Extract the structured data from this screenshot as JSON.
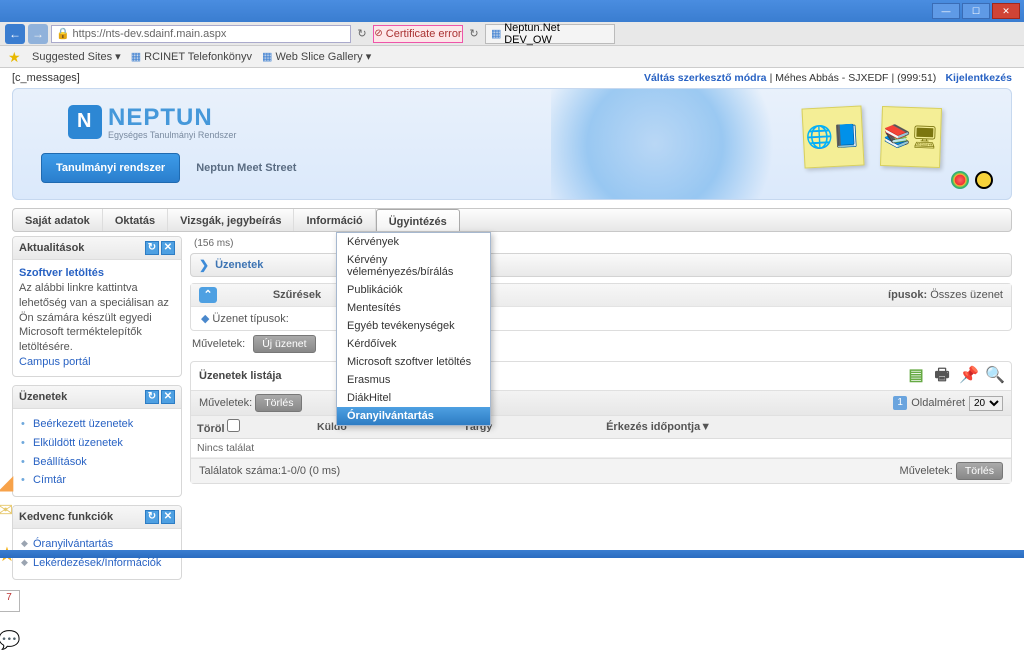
{
  "browser": {
    "url": "https://nts-dev.sdainf.main.aspx",
    "cert_error": "Certificate error",
    "tab_title": "Neptun.Net DEV_OW",
    "fav_sites": "Suggested Sites ▾",
    "fav_phone": "RCINET Telefonkönyv",
    "fav_slice": "Web Slice Gallery ▾"
  },
  "topbar": {
    "messages": "[c_messages]",
    "switch_mode": "Váltás szerkesztő módra",
    "user": "Méhes Abbás - SJXEDF",
    "session": "(999:51)",
    "logout": "Kijelentkezés"
  },
  "logo": {
    "text": "NEPTUN",
    "sub": "Egységes Tanulmányi Rendszer"
  },
  "ribbon": {
    "main": "Tanulmányi rendszer",
    "sec": "Neptun Meet Street"
  },
  "mainmenu": {
    "items": [
      "Saját adatok",
      "Oktatás",
      "Vizsgák, jegybeírás",
      "Információ",
      "Ügyintézés"
    ],
    "active_index": 4
  },
  "submenu": {
    "items": [
      "Kérvények",
      "Kérvény véleményezés/bírálás",
      "Publikációk",
      "Mentesítés",
      "Egyéb tevékenységek",
      "Kérdőívek",
      "Microsoft szoftver letöltés",
      "Erasmus",
      "DiákHitel",
      "Óranyilvántartás"
    ],
    "highlight_index": 9
  },
  "panels": {
    "news": {
      "title": "Aktualitások",
      "link": "Szoftver letöltés",
      "body": "Az alábbi linkre kattintva lehetőség van a speciálisan az Ön számára készült egyedi Microsoft terméktelepítők letöltésére.",
      "campus": "Campus portál"
    },
    "messages": {
      "title": "Üzenetek",
      "items": [
        "Beérkezett üzenetek",
        "Elküldött üzenetek",
        "Beállítások",
        "Címtár"
      ]
    },
    "fav": {
      "title": "Kedvenc funkciók",
      "items": [
        "Óranyilvántartás",
        "Lekérdezések/Információk"
      ]
    }
  },
  "content": {
    "timing": "(156 ms)",
    "heading": "Üzenetek",
    "filters_label": "Szűrések",
    "filter_types_label": "Üzenet típusok:",
    "filter_right_label": "ípusok:",
    "filter_right_val": "Összes üzenet",
    "ops_label": "Műveletek:",
    "new_msg": "Új üzenet",
    "list_title": "Üzenetek listája",
    "delete": "Törlés",
    "pagesize_label": "Oldalméret",
    "pagesize_value": "20",
    "columns": {
      "del": "Töröl",
      "sender": "Küldő",
      "subject": "Tárgy",
      "arrived": "Érkezés időpontja"
    },
    "no_result": "Nincs találat",
    "footer_count": "Találatok száma:1-0/0 (0 ms)"
  },
  "side_cal": "7"
}
